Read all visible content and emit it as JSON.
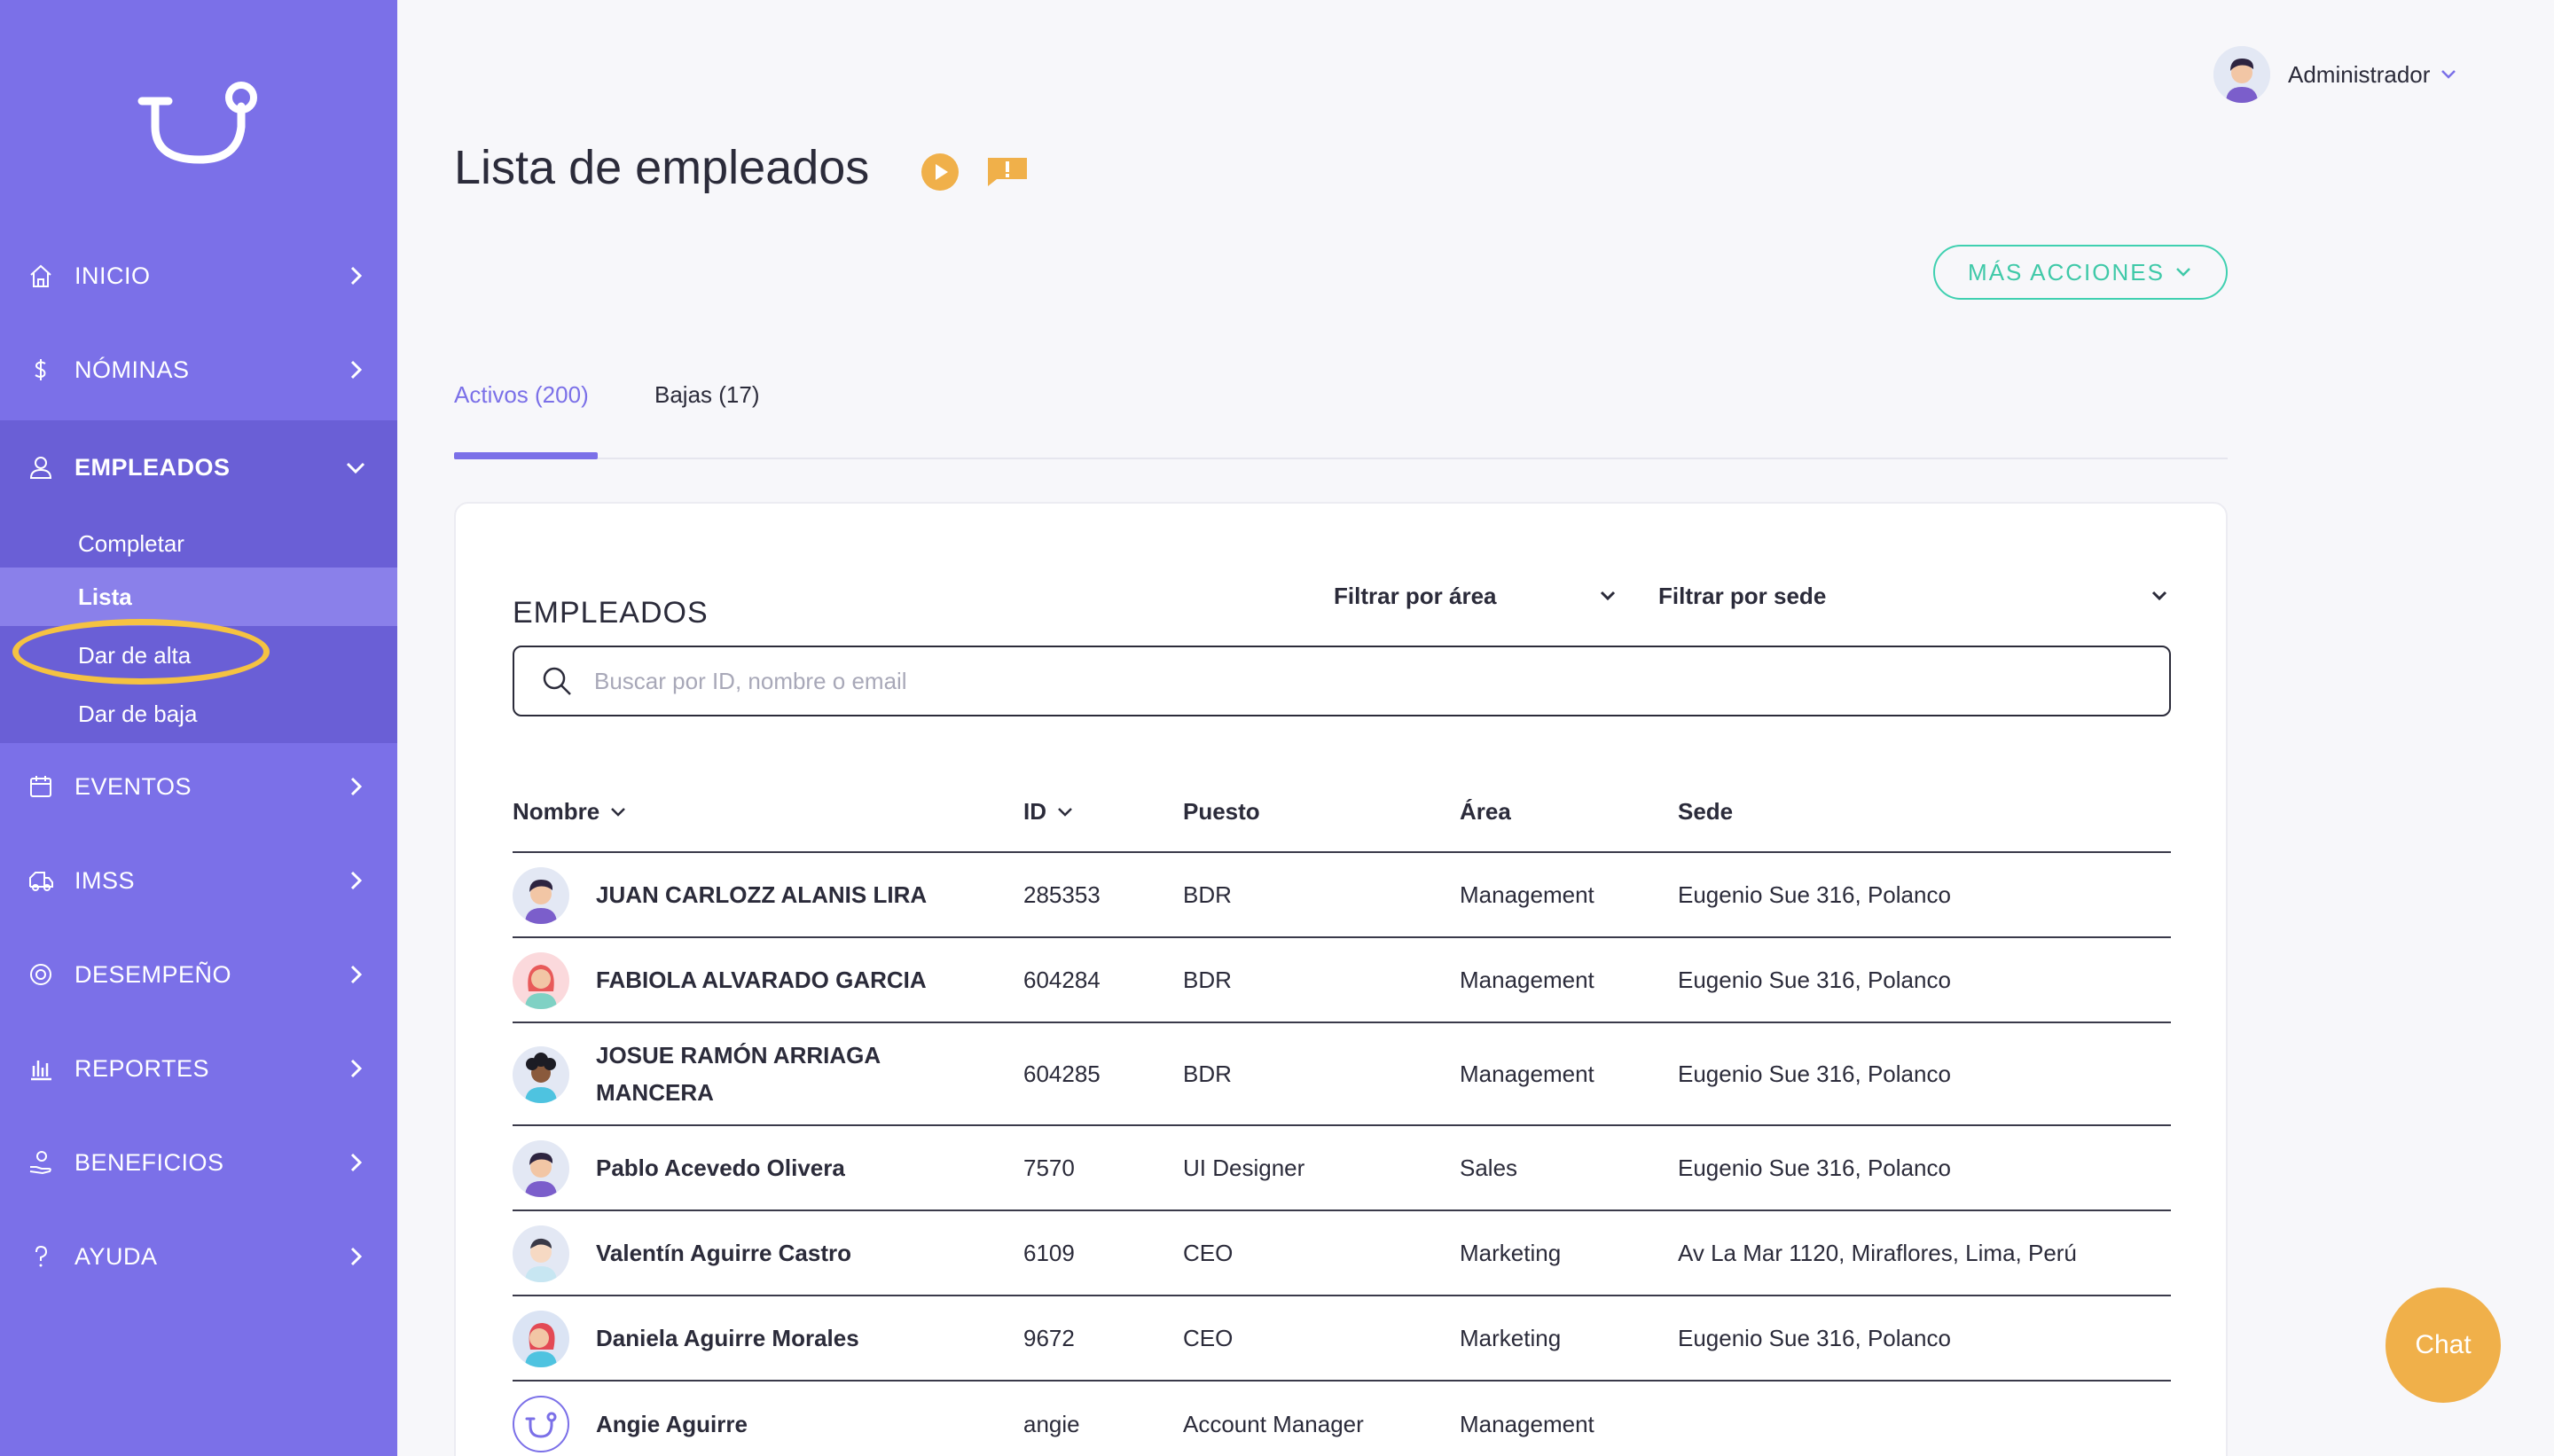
{
  "sidebar": {
    "logo": "tu-logo",
    "items": [
      {
        "label": "INICIO",
        "icon": "home-icon"
      },
      {
        "label": "NÓMINAS",
        "icon": "dollar-icon"
      },
      {
        "label": "EMPLEADOS",
        "icon": "user-icon"
      },
      {
        "label": "EVENTOS",
        "icon": "calendar-icon"
      },
      {
        "label": "IMSS",
        "icon": "ambulance-icon"
      },
      {
        "label": "DESEMPEÑO",
        "icon": "target-icon"
      },
      {
        "label": "REPORTES",
        "icon": "bar-chart-icon"
      },
      {
        "label": "BENEFICIOS",
        "icon": "gift-hand-icon"
      },
      {
        "label": "AYUDA",
        "icon": "question-icon"
      }
    ],
    "submenu": [
      "Completar",
      "Lista",
      "Dar de alta",
      "Dar de baja"
    ]
  },
  "header": {
    "user_name": "Administrador"
  },
  "page": {
    "title": "Lista de empleados",
    "more_actions": "MÁS ACCIONES"
  },
  "tabs": [
    {
      "label": "Activos (200)"
    },
    {
      "label": "Bajas (17)"
    }
  ],
  "card": {
    "title": "EMPLEADOS",
    "filter_area": "Filtrar por área",
    "filter_sede": "Filtrar por sede",
    "search_placeholder": "Buscar por ID, nombre o email"
  },
  "table": {
    "columns": [
      "Nombre",
      "ID",
      "Puesto",
      "Área",
      "Sede"
    ],
    "rows": [
      {
        "name": "JUAN CARLOZZ ALANIS LIRA",
        "id": "285353",
        "puesto": "BDR",
        "area": "Management",
        "sede": "Eugenio Sue 316, Polanco"
      },
      {
        "name": "FABIOLA ALVARADO GARCIA",
        "id": "604284",
        "puesto": "BDR",
        "area": "Management",
        "sede": "Eugenio Sue 316, Polanco"
      },
      {
        "name": "JOSUE RAMÓN ARRIAGA MANCERA",
        "id": "604285",
        "puesto": "BDR",
        "area": "Management",
        "sede": "Eugenio Sue 316, Polanco"
      },
      {
        "name": "Pablo Acevedo Olivera",
        "id": "7570",
        "puesto": "UI Designer",
        "area": "Sales",
        "sede": "Eugenio Sue 316, Polanco"
      },
      {
        "name": "Valentín Aguirre Castro",
        "id": "6109",
        "puesto": "CEO",
        "area": "Marketing",
        "sede": "Av La Mar 1120, Miraflores, Lima, Perú"
      },
      {
        "name": "Daniela Aguirre Morales",
        "id": "9672",
        "puesto": "CEO",
        "area": "Marketing",
        "sede": "Eugenio Sue 316, Polanco"
      },
      {
        "name": "Angie Aguirre",
        "id": "angie",
        "puesto": "Account Manager",
        "area": "Management",
        "sede": ""
      }
    ]
  },
  "chat": {
    "label": "Chat"
  },
  "colors": {
    "sidebar": "#7b70e8",
    "accent": "#7b70e8",
    "teal": "#3fc9a8",
    "orange": "#f0b04a",
    "highlight": "#f5c242"
  }
}
